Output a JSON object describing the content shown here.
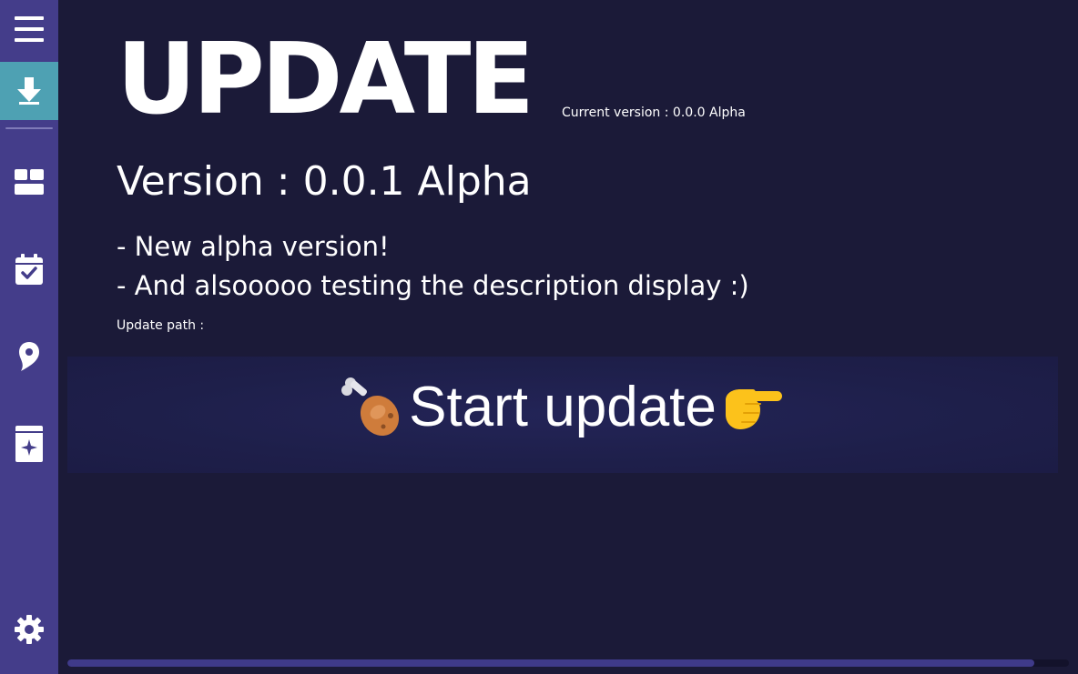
{
  "colors": {
    "background": "#1b1a38",
    "sidebar": "#443d8a",
    "sidebar_active": "#4ea1b3",
    "button_bg": "#1f2050",
    "progress_fill": "#3f3a8a",
    "text": "#ffffff"
  },
  "sidebar": {
    "items": [
      {
        "icon": "menu-icon",
        "active": false
      },
      {
        "icon": "download-icon",
        "active": true
      },
      {
        "icon": "dashboard-icon",
        "active": false
      },
      {
        "icon": "calendar-check-icon",
        "active": false
      },
      {
        "icon": "map-pin-icon",
        "active": false
      },
      {
        "icon": "sparkle-book-icon",
        "active": false
      },
      {
        "icon": "gear-icon",
        "active": false
      }
    ]
  },
  "main": {
    "title": "UPDATE",
    "current_version": "Current version : 0.0.0 Alpha",
    "version_heading": "Version : 0.0.1 Alpha",
    "description": [
      "- New alpha version!",
      "- And alsooooo testing the description display :)"
    ],
    "update_path_label": "Update path :",
    "start_button": {
      "label": "Start update",
      "left_icon": "poultry-leg-icon",
      "right_icon": "pointing-hand-icon"
    },
    "progress": {
      "fraction": 0.965
    }
  }
}
